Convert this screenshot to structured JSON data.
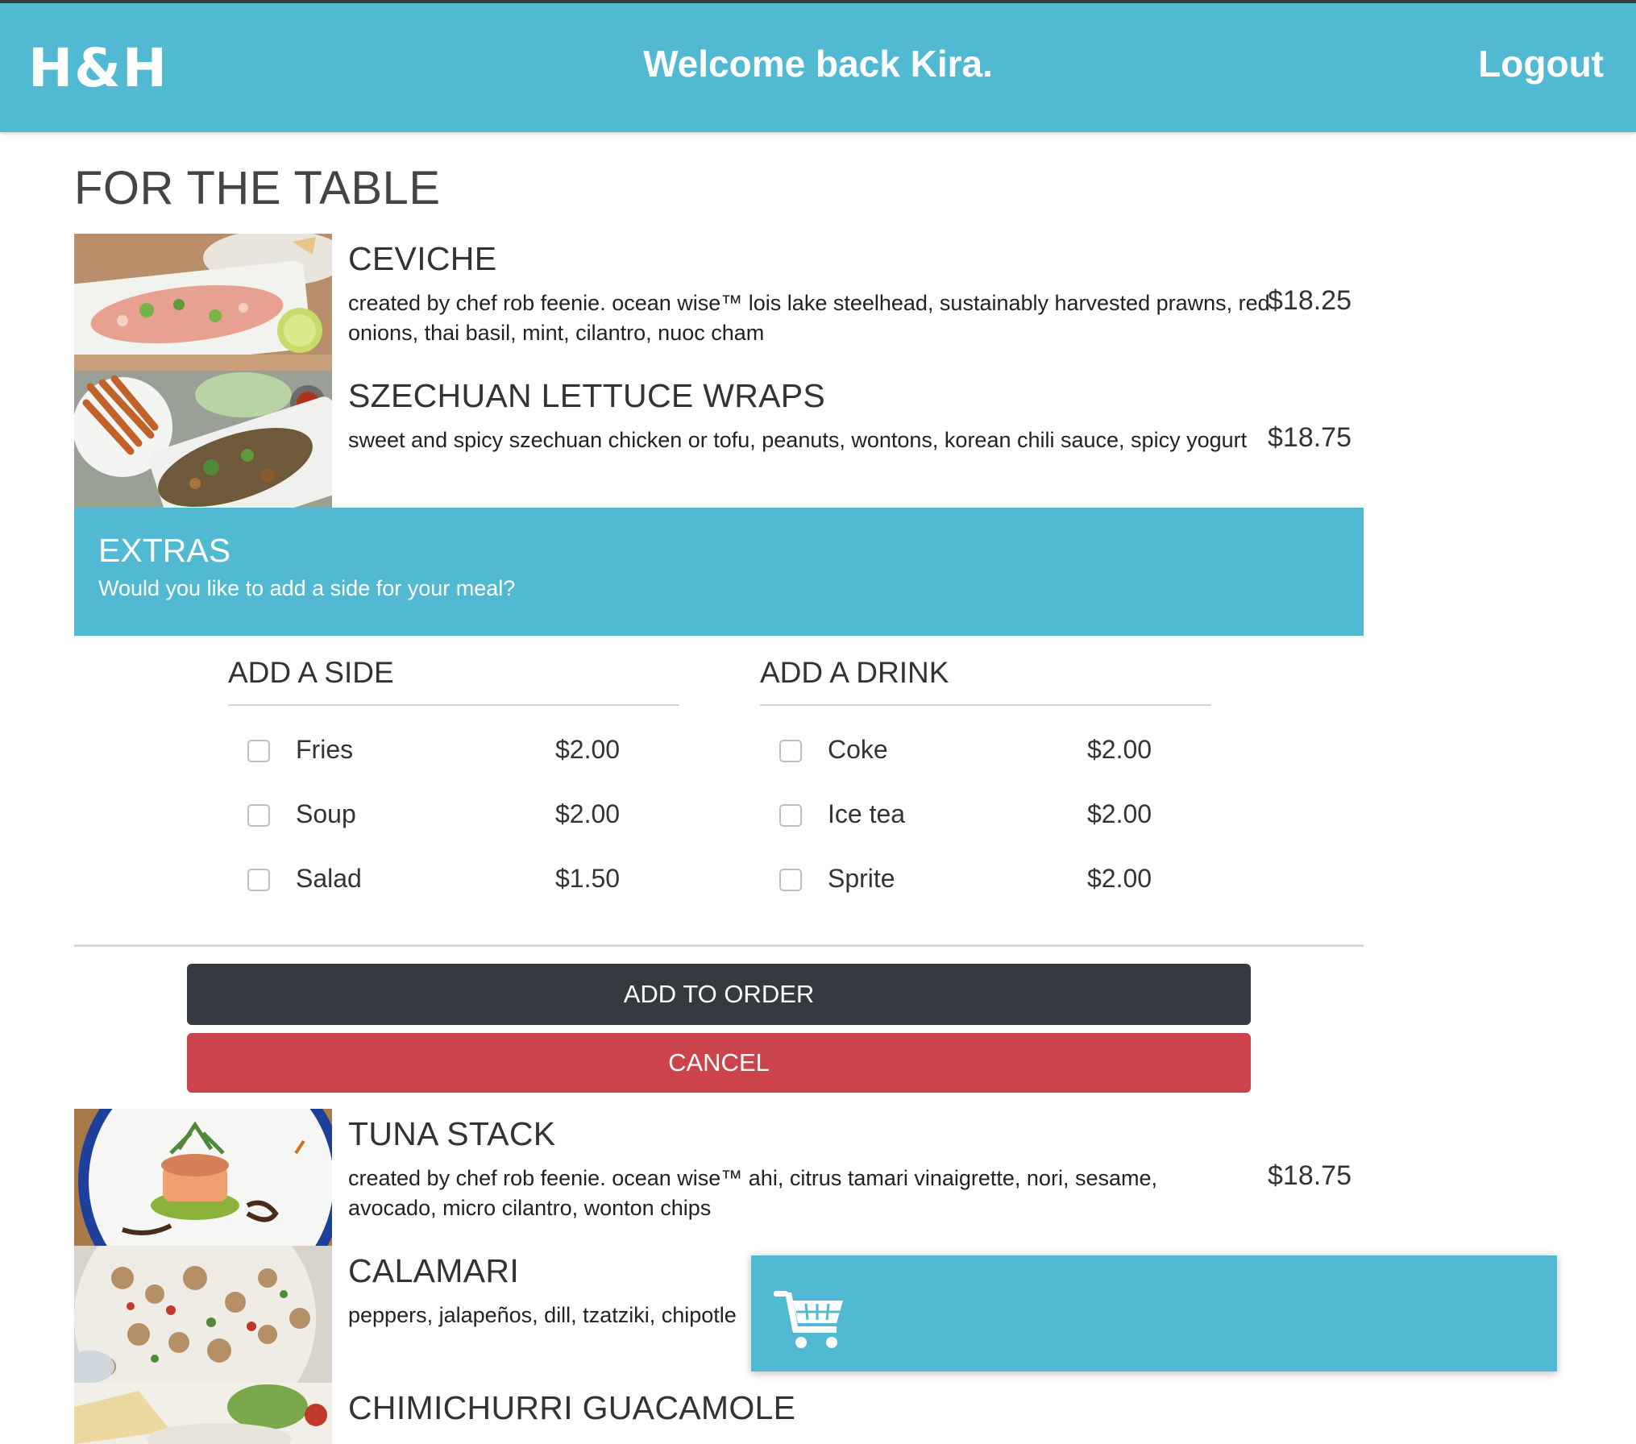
{
  "header": {
    "logo": "H&H",
    "welcome": "Welcome back Kira.",
    "logout_label": "Logout"
  },
  "section_title": "FOR THE TABLE",
  "menu_items": [
    {
      "name": "CEVICHE",
      "description": "created by chef rob feenie. ocean wise™ lois lake steelhead, sustainably harvested prawns, red onions, thai basil, mint, cilantro, nuoc cham",
      "price": "$18.25"
    },
    {
      "name": "SZECHUAN LETTUCE WRAPS",
      "description": "sweet and spicy szechuan chicken or tofu, peanuts, wontons, korean chili sauce, spicy yogurt",
      "price": "$18.75"
    },
    {
      "name": "TUNA STACK",
      "description": "created by chef rob feenie. ocean wise™ ahi, citrus tamari vinaigrette, nori, sesame, avocado, micro cilantro, wonton chips",
      "price": "$18.75"
    },
    {
      "name": "CALAMARI",
      "description": "peppers, jalapeños, dill, tzatziki, chipotle",
      "price": ""
    },
    {
      "name": "CHIMICHURRI GUACAMOLE",
      "description": "",
      "price": ""
    }
  ],
  "extras": {
    "title": "EXTRAS",
    "subtitle": "Would you like to add a side for your meal?",
    "sides": {
      "title": "ADD A SIDE",
      "options": [
        {
          "label": "Fries",
          "price": "$2.00",
          "checked": false
        },
        {
          "label": "Soup",
          "price": "$2.00",
          "checked": false
        },
        {
          "label": "Salad",
          "price": "$1.50",
          "checked": false
        }
      ]
    },
    "drinks": {
      "title": "ADD A DRINK",
      "options": [
        {
          "label": "Coke",
          "price": "$2.00",
          "checked": false
        },
        {
          "label": "Ice tea",
          "price": "$2.00",
          "checked": false
        },
        {
          "label": "Sprite",
          "price": "$2.00",
          "checked": false
        }
      ]
    }
  },
  "buttons": {
    "add_to_order": "ADD TO ORDER",
    "cancel": "CANCEL"
  },
  "cart": {
    "icon": "shopping-cart-icon"
  },
  "colors": {
    "accent": "#52b9d2",
    "dark_button": "#343a40",
    "cancel_button": "#cc444b"
  }
}
